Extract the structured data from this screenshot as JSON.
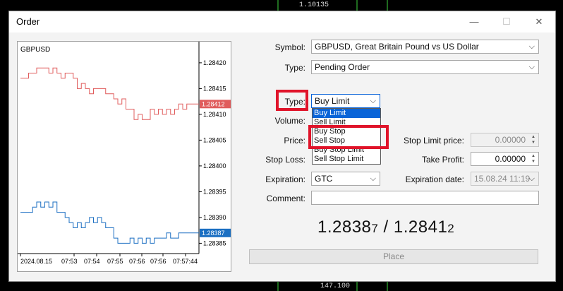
{
  "background": {
    "top_label": "1.10135",
    "bottom_label": "147.100"
  },
  "window": {
    "title": "Order",
    "minimize_glyph": "—",
    "maximize_glyph": "☐",
    "close_glyph": "✕"
  },
  "chart": {
    "symbol": "GBPUSD",
    "price_ticks": [
      "1.28420",
      "1.28415",
      "1.28410",
      "1.28405",
      "1.28400",
      "1.28395",
      "1.28390",
      "1.28385"
    ],
    "time_ticks": [
      "2024.08.15",
      "07:53",
      "07:54",
      "07:55",
      "07:56",
      "07:56",
      "07:57:44"
    ],
    "ask_label": "1.28412",
    "bid_label": "1.28387",
    "ask_color": "#e05c5c",
    "bid_color": "#1b6fc2",
    "ask_series": [
      1.28417,
      1.28417,
      1.28418,
      1.28418,
      1.28419,
      1.28419,
      1.28419,
      1.28418,
      1.28419,
      1.28418,
      1.28417,
      1.28418,
      1.28418,
      1.28417,
      1.28415,
      1.28416,
      1.28415,
      1.28414,
      1.28415,
      1.28415,
      1.28415,
      1.28414,
      1.28414,
      1.28413,
      1.28412,
      1.28413,
      1.28411,
      1.28411,
      1.28409,
      1.2841,
      1.28409,
      1.28409,
      1.28411,
      1.2841,
      1.28411,
      1.2841,
      1.28411,
      1.2841,
      1.28411,
      1.28412,
      1.28411,
      1.28412,
      1.28412,
      1.28412,
      1.28412
    ],
    "bid_series": [
      1.28391,
      1.28391,
      1.28391,
      1.28392,
      1.28393,
      1.28392,
      1.28393,
      1.28392,
      1.28393,
      1.28391,
      1.28391,
      1.2839,
      1.28389,
      1.28388,
      1.28389,
      1.28388,
      1.28389,
      1.2839,
      1.28389,
      1.2839,
      1.28389,
      1.28388,
      1.28388,
      1.28386,
      1.28385,
      1.28385,
      1.28385,
      1.28386,
      1.28385,
      1.28386,
      1.28385,
      1.28386,
      1.28385,
      1.28386,
      1.28386,
      1.28386,
      1.28387,
      1.28386,
      1.28386,
      1.28387,
      1.28387,
      1.28387,
      1.28387,
      1.28387,
      1.28387
    ]
  },
  "form": {
    "symbol_label": "Symbol:",
    "symbol_value": "GBPUSD, Great Britain Pound vs US Dollar",
    "type_label": "Type:",
    "type_value": "Pending Order",
    "order_type_label": "Type:",
    "order_type_value": "Buy Limit",
    "volume_label": "Volume:",
    "price_label": "Price:",
    "stop_loss_label": "Stop Loss:",
    "stop_limit_price_label": "Stop Limit price:",
    "stop_limit_price_value": "0.00000",
    "take_profit_label": "Take Profit:",
    "take_profit_value": "0.00000",
    "expiration_label": "Expiration:",
    "expiration_value": "GTC",
    "expiration_date_label": "Expiration date:",
    "expiration_date_value": "15.08.24 11:19",
    "comment_label": "Comment:",
    "comment_value": ""
  },
  "dropdown": {
    "options": [
      "Buy Limit",
      "Sell Limit",
      "Buy Stop",
      "Sell Stop",
      "Buy Stop Limit",
      "Sell Stop Limit"
    ],
    "selected_index": 0
  },
  "quote": {
    "bid_main": "1.2838",
    "bid_small": "7",
    "separator": " / ",
    "ask_main": "1.2841",
    "ask_small": "2"
  },
  "place_button_label": "Place",
  "colors": {
    "highlight_red": "#e0142a",
    "selection_blue": "#0a64d8"
  }
}
